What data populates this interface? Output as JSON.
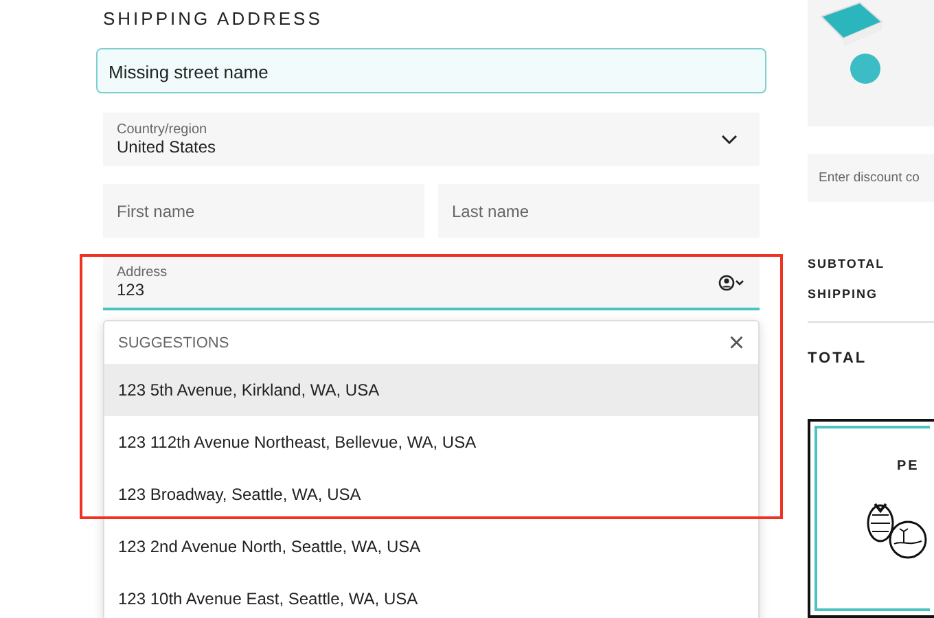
{
  "shipping_address": {
    "title": "SHIPPING ADDRESS",
    "error": "Missing street name",
    "country": {
      "label": "Country/region",
      "value": "United States"
    },
    "first_name": {
      "placeholder": "First name"
    },
    "last_name": {
      "placeholder": "Last name"
    },
    "address": {
      "label": "Address",
      "value": "123"
    },
    "suggestions": {
      "header": "SUGGESTIONS",
      "close": "×",
      "items": [
        {
          "text": "123 5th Avenue, Kirkland, WA, USA",
          "selected": true
        },
        {
          "text": "123 112th Avenue Northeast, Bellevue, WA, USA",
          "selected": false
        },
        {
          "text": "123 Broadway, Seattle, WA, USA",
          "selected": false
        },
        {
          "text": "123 2nd Avenue North, Seattle, WA, USA",
          "selected": false
        },
        {
          "text": "123 10th Avenue East, Seattle, WA, USA",
          "selected": false
        }
      ]
    }
  },
  "order_summary": {
    "discount": {
      "placeholder": "Enter discount co"
    },
    "lines": [
      {
        "label": "SUBTOTAL"
      },
      {
        "label": "SHIPPING"
      }
    ],
    "total": {
      "label": "TOTAL"
    },
    "promo": {
      "title": "PE"
    }
  }
}
